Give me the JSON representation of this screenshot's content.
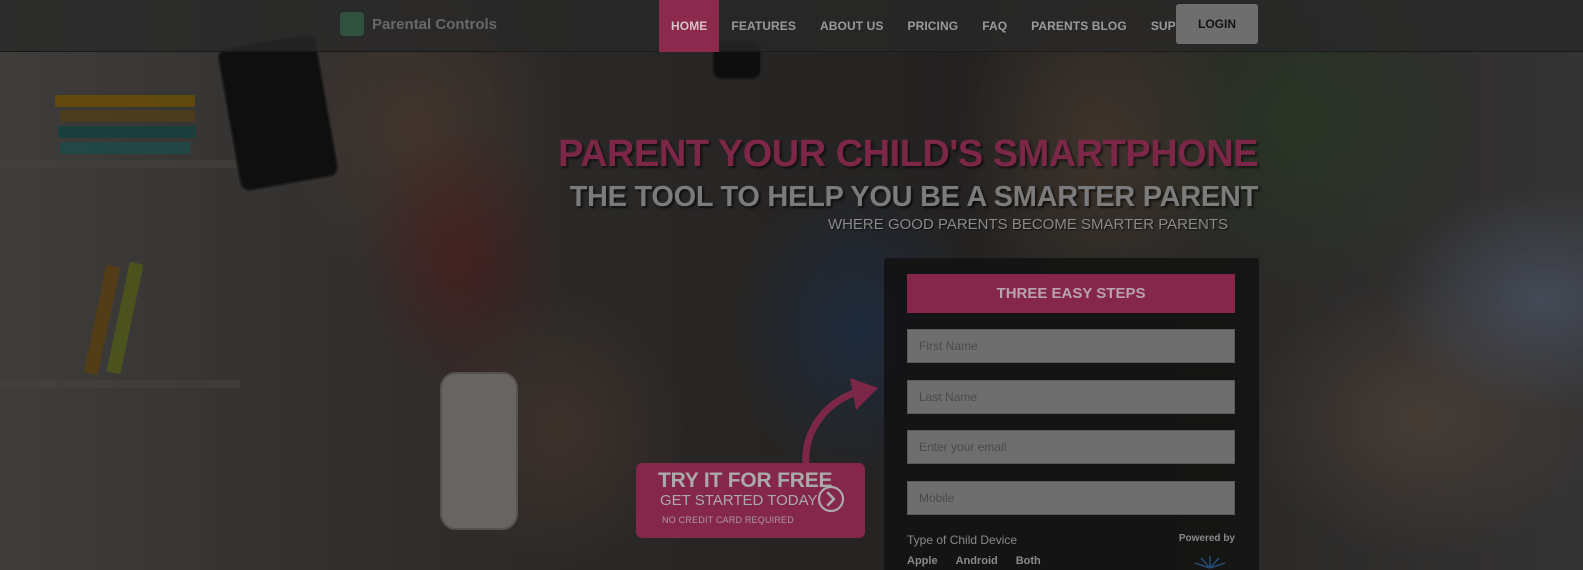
{
  "nav": {
    "logo_text": "Parental Controls",
    "items": [
      {
        "label": "HOME",
        "active": true
      },
      {
        "label": "FEATURES",
        "active": false
      },
      {
        "label": "ABOUT US",
        "active": false
      },
      {
        "label": "PRICING",
        "active": false
      },
      {
        "label": "FAQ",
        "active": false
      },
      {
        "label": "PARENTS BLOG",
        "active": false
      },
      {
        "label": "SUPPORT",
        "active": false
      }
    ],
    "login_label": "LOGIN"
  },
  "hero": {
    "headline": "PARENT YOUR CHILD'S SMARTPHONE",
    "subhead": "THE TOOL TO HELP YOU BE A SMARTER PARENT",
    "tagline": "WHERE GOOD PARENTS BECOME SMARTER PARENTS"
  },
  "form": {
    "header": "THREE EASY STEPS",
    "first_name_placeholder": "First Name",
    "last_name_placeholder": "Last Name",
    "email_placeholder": "Enter your email",
    "mobile_placeholder": "Mobile",
    "device_label": "Type of Child Device",
    "device_options": [
      "Apple",
      "Android",
      "Both"
    ],
    "powered_by": "Powered by"
  },
  "cta": {
    "line1": "TRY IT FOR FREE",
    "line2": "GET STARTED TODAY",
    "line3": "NO CREDIT CARD REQUIRED"
  },
  "colors": {
    "accent": "#85274a",
    "overlay": "#000000"
  }
}
